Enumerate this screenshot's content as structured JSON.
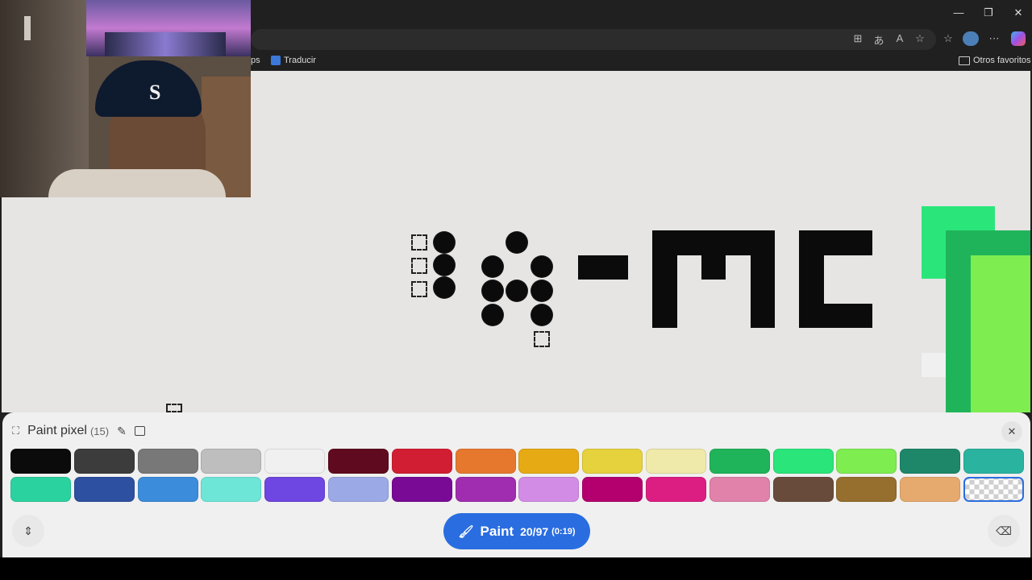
{
  "browser": {
    "window_controls": {
      "minimize": "—",
      "maximize": "❐",
      "close": "✕"
    },
    "toolbar_icons": [
      "apps-icon",
      "translate-icon",
      "read-aloud-icon",
      "favorite-star-icon",
      "favorites-icon",
      "profile-icon",
      "more-icon",
      "copilot-icon"
    ],
    "bookmarks": {
      "partial": "ps",
      "translate": "Traducir",
      "other": "Otros favoritos"
    }
  },
  "panel": {
    "title": "Paint pixel",
    "count": "(15)",
    "colors": [
      "#0b0b0b",
      "#3c3c3c",
      "#787878",
      "#bebebe",
      "#f0f0f0",
      "#5f0a1e",
      "#d21e32",
      "#e6782d",
      "#e6aa14",
      "#e6d23c",
      "#f0eaaa",
      "#20b45a",
      "#2ae67a",
      "#7ded50",
      "#1e8769",
      "#2ab4a0",
      "#2ad2a0",
      "#2d50a0",
      "#3c8cdc",
      "#6ee6d7",
      "#6e46e1",
      "#9baae6",
      "#780a96",
      "#a02daf",
      "#d28ce6",
      "#b4006e",
      "#dc1e82",
      "#e182aa",
      "#694b3c",
      "#966e2d",
      "#e6aa6e",
      "transparent"
    ],
    "paint_button": {
      "label": "Paint",
      "progress": "20/97",
      "time": "(0:19)"
    }
  },
  "canvas_text": "Q-MC"
}
